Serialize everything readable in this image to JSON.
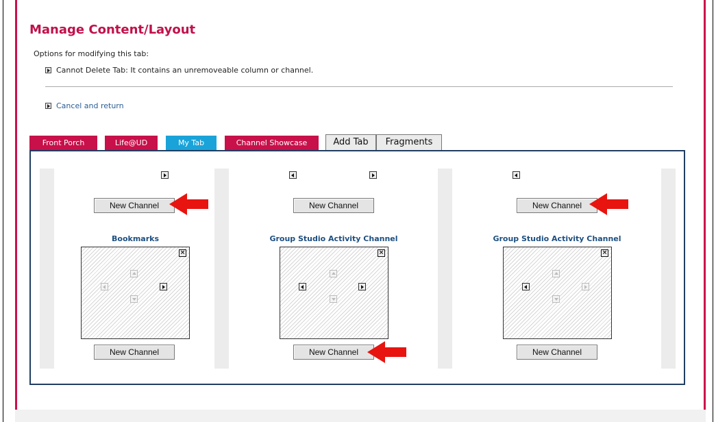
{
  "page": {
    "title": "Manage Content/Layout",
    "options_heading": "Options for modifying this tab:",
    "cannot_delete": "Cannot Delete Tab: It contains an unremoveable column or channel.",
    "cancel_label": "Cancel and return"
  },
  "tabs": [
    {
      "label": "Front Porch",
      "state": "inactive"
    },
    {
      "label": "Life@UD",
      "state": "inactive"
    },
    {
      "label": "My Tab",
      "state": "active"
    },
    {
      "label": "Channel Showcase",
      "state": "inactive"
    },
    {
      "label": "Add Tab",
      "state": "action"
    },
    {
      "label": "Fragments",
      "state": "action"
    }
  ],
  "columns": [
    {
      "new_channel_top": "New Channel",
      "channel_title": "Bookmarks",
      "new_channel_bottom": "New Channel"
    },
    {
      "new_channel_top": "New Channel",
      "channel_title": "Group Studio Activity Channel",
      "new_channel_bottom": "New Channel"
    },
    {
      "new_channel_top": "New Channel",
      "channel_title": "Group Studio Activity Channel",
      "new_channel_bottom": "New Channel"
    }
  ],
  "icons": {
    "move_right": "arrow-right-icon",
    "move_left": "arrow-left-icon",
    "move_up": "arrow-up-icon",
    "move_down": "arrow-down-icon",
    "close": "close-icon",
    "bullet": "triangle-bullet-icon",
    "annotation": "red-arrow-icon"
  },
  "colors": {
    "brand": "#c8104b",
    "active_tab": "#1aa3d9",
    "link": "#2a5d95",
    "layout_border": "#1f3d61",
    "annotation_arrow": "#e8140f"
  }
}
